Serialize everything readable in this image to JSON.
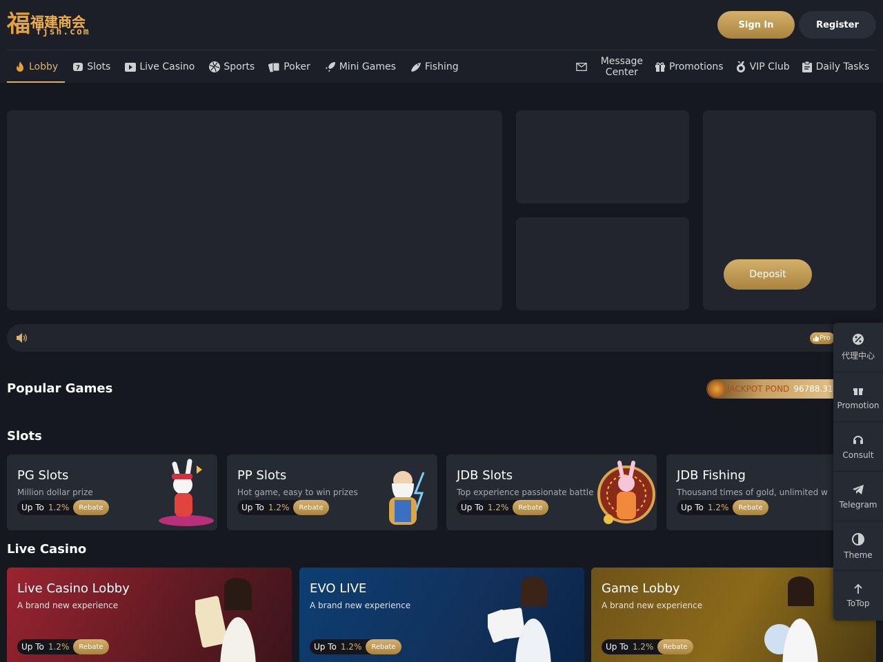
{
  "brand": {
    "logo_mark": "福",
    "logo_cn": "福建商会",
    "logo_en": "fjsh.com"
  },
  "header": {
    "signin_label": "Sign In",
    "register_label": "Register"
  },
  "nav": {
    "items": [
      {
        "label": "Lobby",
        "icon": "flame-icon",
        "active": true
      },
      {
        "label": "Slots",
        "icon": "slot-seven-icon"
      },
      {
        "label": "Live Casino",
        "icon": "play-icon"
      },
      {
        "label": "Sports",
        "icon": "ball-icon"
      },
      {
        "label": "Poker",
        "icon": "cards-icon"
      },
      {
        "label": "Mini Games",
        "icon": "rocket-icon"
      },
      {
        "label": "Fishing",
        "icon": "fish-icon"
      }
    ],
    "right": {
      "message_line1": "Message",
      "message_line2": "Center",
      "promotions": "Promotions",
      "vip": "VIP Club",
      "tasks": "Daily Tasks"
    }
  },
  "banner": {
    "deposit_label": "Deposit"
  },
  "marquee": {
    "promo_chip": "Pro"
  },
  "popular": {
    "title": "Popular Games",
    "jackpot_label": "JACKPOT POND",
    "jackpot_value": "96788.31"
  },
  "slots": {
    "title": "Slots",
    "cards": [
      {
        "title": "PG Slots",
        "subtitle": "Million dollar prize",
        "upto": "Up To",
        "pct": "1.2%",
        "tag": "Rebate"
      },
      {
        "title": "PP Slots",
        "subtitle": "Hot game, easy to win prizes",
        "upto": "Up To",
        "pct": "1.2%",
        "tag": "Rebate"
      },
      {
        "title": "JDB Slots",
        "subtitle": "Top experience passionate battle",
        "upto": "Up To",
        "pct": "1.2%",
        "tag": "Rebate"
      },
      {
        "title": "JDB Fishing",
        "subtitle": "Thousand times of gold, unlimited w",
        "upto": "Up To",
        "pct": "1.2%",
        "tag": "Rebate"
      }
    ]
  },
  "live": {
    "title": "Live Casino",
    "cards": [
      {
        "title": "Live Casino Lobby",
        "subtitle": "A brand new experience",
        "upto": "Up To",
        "pct": "1.2%",
        "tag": "Rebate"
      },
      {
        "title": "EVO LIVE",
        "subtitle": "A brand new experience",
        "upto": "Up To",
        "pct": "1.2%",
        "tag": "Rebate"
      },
      {
        "title": "Game Lobby",
        "subtitle": "A brand new experience",
        "upto": "Up To",
        "pct": "1.2%",
        "tag": "Rebate"
      }
    ]
  },
  "float_bar": {
    "agent": "代理中心",
    "promotion": "Promotion",
    "consult": "Consult",
    "telegram": "Telegram",
    "theme": "Theme",
    "totop": "ToTop"
  },
  "colors": {
    "gold": "#d8b36d",
    "bg": "#16181f",
    "panel": "#22252d"
  }
}
